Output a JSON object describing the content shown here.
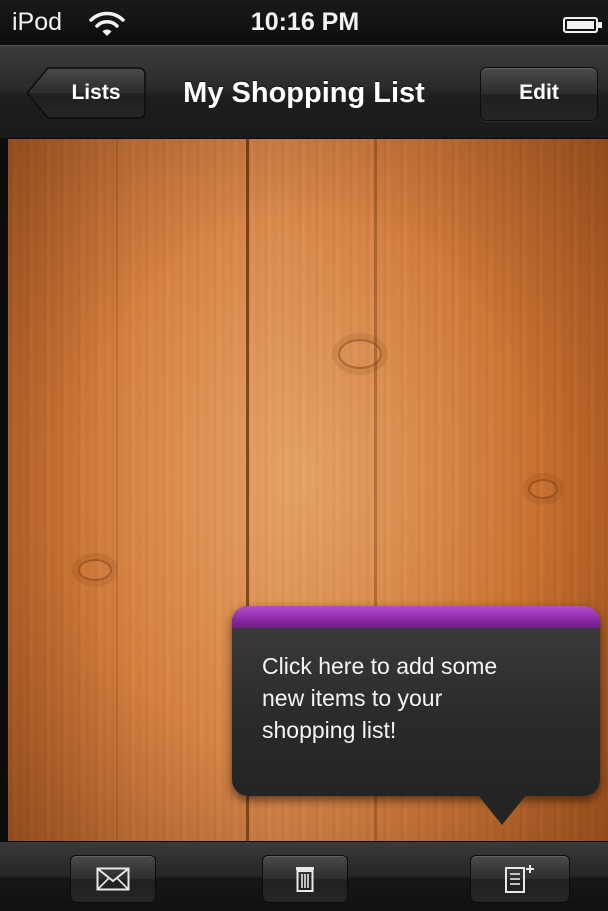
{
  "status_bar": {
    "carrier": "iPod",
    "time": "10:16 PM",
    "wifi_icon": "wifi-icon",
    "battery_icon": "battery-icon"
  },
  "nav_bar": {
    "back_label": "Lists",
    "title": "My Shopping List",
    "edit_label": "Edit"
  },
  "tooltip": {
    "line1": "Click here to add some",
    "line2": "new items to your",
    "line3": "shopping list!",
    "accent_color": "#8b2aa6"
  },
  "toolbar": {
    "items": [
      {
        "icon": "mail-icon"
      },
      {
        "icon": "trash-icon"
      },
      {
        "icon": "add-item-icon"
      }
    ]
  },
  "colors": {
    "wood": "#d17c3c",
    "bar": "#2b2b2b",
    "tooltip_accent": "#8b2aa6"
  }
}
